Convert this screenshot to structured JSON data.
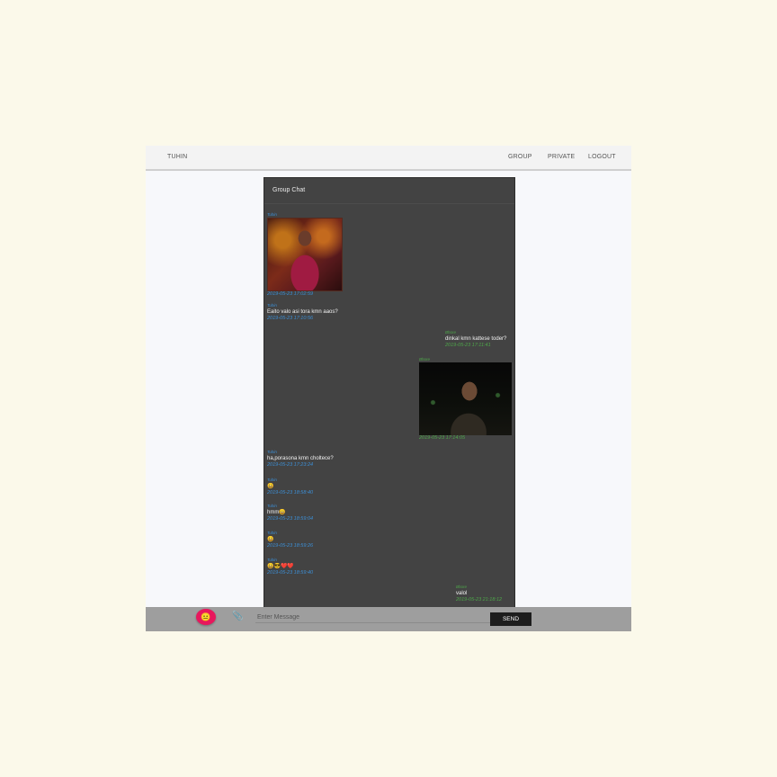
{
  "navbar": {
    "brand": "TUHIN",
    "links": [
      "GROUP",
      "PRIVATE",
      "LOGOUT"
    ]
  },
  "chat": {
    "title": "Group Chat",
    "messages": [
      {
        "side": "left",
        "sender": "Tuhin",
        "type": "image",
        "time": "2019-05-23 17:02:59"
      },
      {
        "side": "left",
        "sender": "Tuhin",
        "text": "Eaito valo asi tora kmn aaos?",
        "time": "2019-05-23 17:10:56"
      },
      {
        "side": "right",
        "sender": "Bhore",
        "text": "dinkal kmn kattese toder?",
        "time": "2019-05-23 17:11:41"
      },
      {
        "side": "right",
        "sender": "Bhore",
        "type": "image",
        "time": "2019-05-23 17:14:05"
      },
      {
        "side": "left",
        "sender": "Tuhin",
        "text": "ha,porasona kmn choltece?",
        "time": "2019-05-23 17:23:24"
      },
      {
        "side": "left",
        "sender": "Tuhin",
        "text": "😀",
        "time": "2019-05-23 18:58:40"
      },
      {
        "side": "left",
        "sender": "Tuhin",
        "text": "hmm😀",
        "time": "2019-05-23 18:59:04"
      },
      {
        "side": "left",
        "sender": "Tuhin",
        "text": "😀",
        "time": "2019-05-23 18:59:26"
      },
      {
        "side": "left",
        "sender": "Tuhin",
        "text": "😀😎❤️❤️",
        "time": "2019-05-23 18:59:40"
      },
      {
        "side": "right",
        "sender": "Bhore",
        "text": "valol",
        "time": "2019-05-23 21:18:12"
      }
    ]
  },
  "composer": {
    "emoji_icon": "😐",
    "attach_icon": "📎",
    "placeholder": "Enter Message",
    "send_label": "SEND"
  },
  "colors": {
    "left_sender": "#3c8fd6",
    "right_sender": "#4ea74a",
    "emoji_button": "#e8175d",
    "chat_bg": "#434343"
  }
}
